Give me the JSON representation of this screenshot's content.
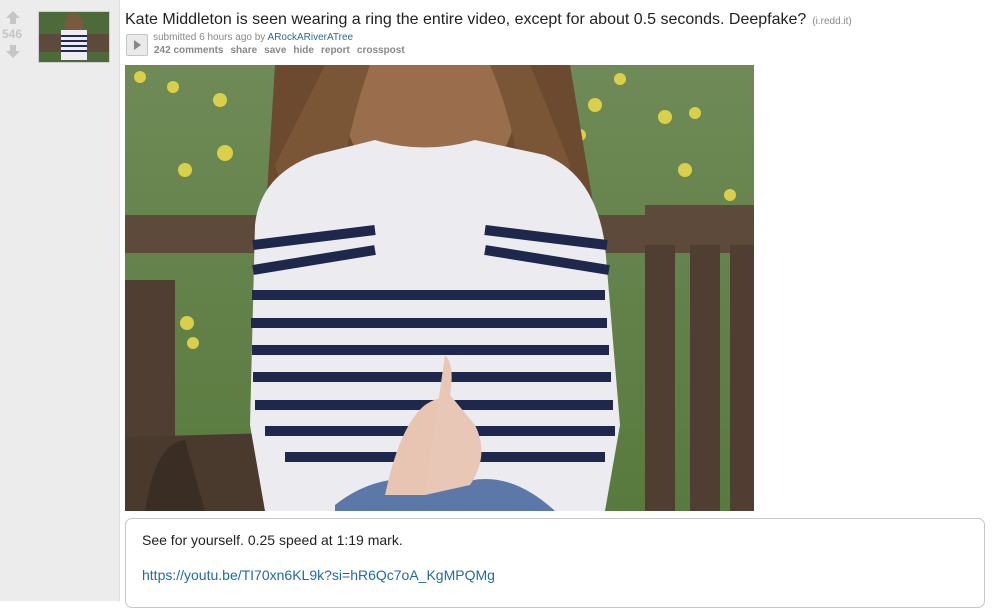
{
  "post": {
    "score": "546",
    "title": "Kate Middleton is seen wearing a ring the entire video, except for about 0.5 seconds. Deepfake?",
    "domain": "(i.redd.it)",
    "tagline_prefix": "submitted 6 hours ago by",
    "author": "ARockARiverATree",
    "actions": {
      "comments": "242 comments",
      "share": "share",
      "save": "save",
      "hide": "hide",
      "report": "report",
      "crosspost": "crosspost"
    }
  },
  "selftext": {
    "line1": "See for yourself. 0.25 speed at 1:19 mark.",
    "link": "https://youtu.be/TI70xn6KL9k?si=hR6Qc7oA_KgMPQMg"
  }
}
